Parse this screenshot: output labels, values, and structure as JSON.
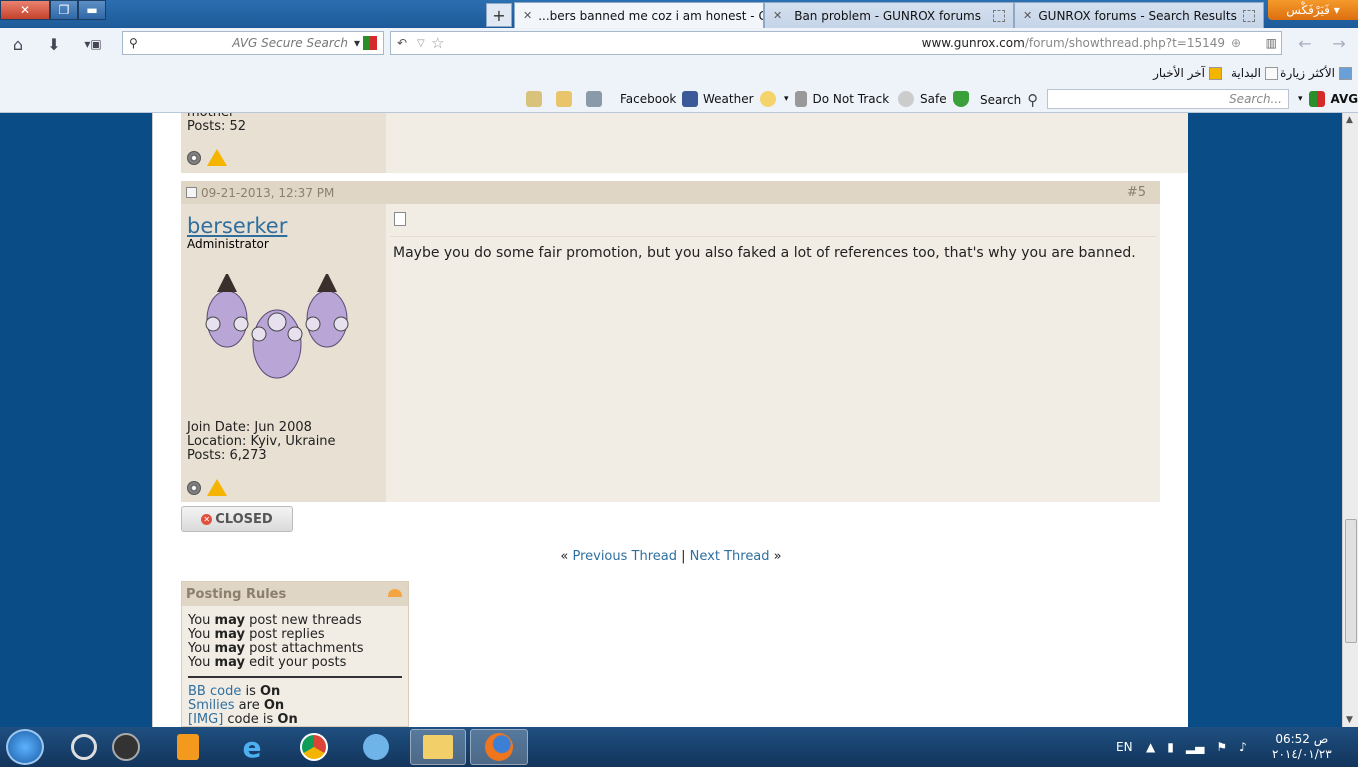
{
  "window": {
    "menu_label": "فَيَرْفَكْس ▾"
  },
  "tabs": [
    {
      "label": "...bers banned me coz i am honest - GU",
      "active": true
    },
    {
      "label": "Ban problem - GUNROX forums",
      "active": false
    },
    {
      "label": "GUNROX forums - Search Results",
      "active": false
    }
  ],
  "nav": {
    "search_placeholder": "AVG Secure Search",
    "url_domain": "www.gunrox.com",
    "url_path": "/forum/showthread.php?t=15149"
  },
  "bookmarks": [
    {
      "label": "الأكثر زيارة"
    },
    {
      "label": "البداية"
    },
    {
      "label": "آخر الأخبار"
    }
  ],
  "avg_toolbar": {
    "facebook": "Facebook",
    "weather": "Weather",
    "do_not_track": "Do Not Track",
    "safe": "Safe",
    "search": "Search",
    "search_placeholder": "Search...",
    "brand": "AVG"
  },
  "prev_post": {
    "location_tail": "mother",
    "posts": "Posts: 52"
  },
  "post": {
    "date": "09-21-2013, 12:37 PM",
    "number_prefix": "#",
    "number": "5",
    "username": "berserker",
    "user_title": "Administrator",
    "join_date": "Join Date: Jun 2008",
    "location": "Location: Kyiv, Ukraine",
    "posts": "Posts: 6,273",
    "message": "Maybe you do some fair promotion, but you also faked a lot of references too, that's why you are banned."
  },
  "closed_label": "CLOSED",
  "thread_nav": {
    "prev": "Previous Thread",
    "sep": "|",
    "next": "Next Thread",
    "left_quote": "«",
    "right_quote": "»"
  },
  "posting_rules": {
    "title": "Posting Rules",
    "lines": [
      {
        "pre": "You ",
        "bold": "may",
        "post": " post new threads"
      },
      {
        "pre": "You ",
        "bold": "may",
        "post": " post replies"
      },
      {
        "pre": "You ",
        "bold": "may",
        "post": " post attachments"
      },
      {
        "pre": "You ",
        "bold": "may",
        "post": " edit your posts"
      }
    ],
    "codes": [
      {
        "link": "BB code",
        "mid": " is ",
        "state": "On"
      },
      {
        "link": "Smilies",
        "mid": " are ",
        "state": "On"
      },
      {
        "link": "[IMG]",
        "mid": " code is ",
        "state": "On"
      }
    ]
  },
  "tray": {
    "lang": "EN",
    "time": "06:52 ص",
    "date": "٢٠١٤/٠١/٢٣"
  },
  "colors": {
    "accent": "#2f6f9f",
    "post_header": "#e0d6c5",
    "post_body": "#f2ede4",
    "user_panel": "#e8e0d3"
  }
}
